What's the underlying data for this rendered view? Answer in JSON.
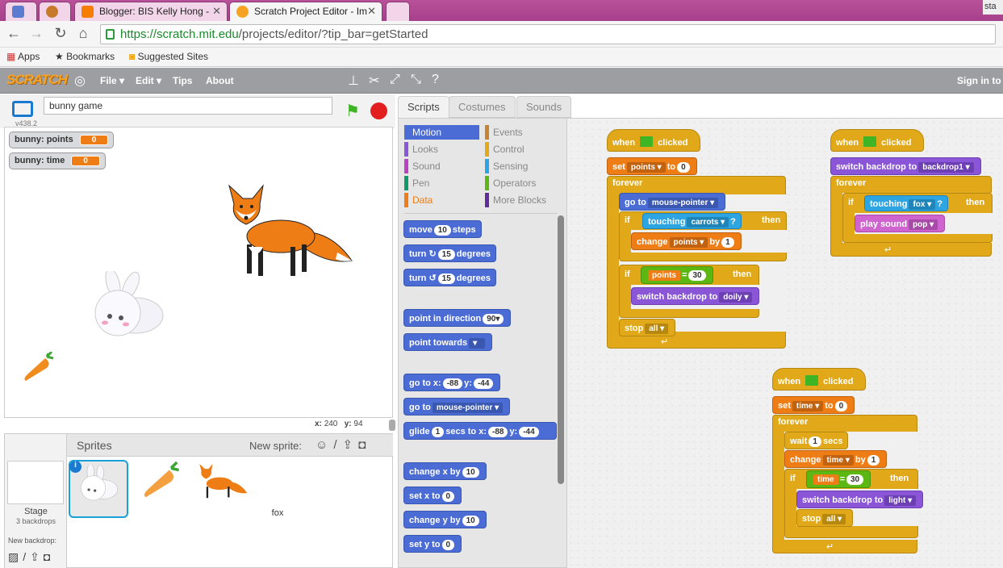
{
  "browser": {
    "tabs": [
      {
        "label": ""
      },
      {
        "label": "Blogger: BIS Kelly Hong -"
      },
      {
        "label": "Scratch Project Editor - Im"
      },
      {
        "label": ""
      }
    ],
    "url_prefix": "https://scratch.mit.edu",
    "url_rest": "/projects/editor/?tip_bar=getStarted",
    "bookmarks": [
      "Apps",
      "Bookmarks",
      "Suggested Sites"
    ],
    "corner_text": "sta"
  },
  "menubar": {
    "logo": "SCRATCH",
    "items": [
      "File ▾",
      "Edit ▾",
      "Tips",
      "About"
    ],
    "signin": "Sign in to s"
  },
  "stage": {
    "project_name": "bunny game",
    "version": "v438.2",
    "monitors": [
      {
        "label": "bunny: points",
        "value": "0"
      },
      {
        "label": "bunny: time",
        "value": "0"
      }
    ],
    "x_label": "x:",
    "x_value": "240",
    "y_label": "y:",
    "y_value": "94"
  },
  "sprites": {
    "header": "Sprites",
    "new_sprite": "New sprite:",
    "stage_label": "Stage",
    "stage_sub": "3 backdrops",
    "new_backdrop": "New backdrop:",
    "items": [
      "bunny",
      "carrots",
      "fox"
    ]
  },
  "editor_tabs": [
    "Scripts",
    "Costumes",
    "Sounds"
  ],
  "categories": {
    "left": [
      "Motion",
      "Looks",
      "Sound",
      "Pen",
      "Data"
    ],
    "right": [
      "Events",
      "Control",
      "Sensing",
      "Operators",
      "More Blocks"
    ]
  },
  "palette_blocks": {
    "move": [
      "move",
      "10",
      "steps"
    ],
    "turn_right": [
      "turn",
      "15",
      "degrees"
    ],
    "turn_left": [
      "turn",
      "15",
      "degrees"
    ],
    "point_dir": [
      "point in direction",
      "90▾"
    ],
    "point_towards": [
      "point towards"
    ],
    "goto_xy": [
      "go to x:",
      "-88",
      "y:",
      "-44"
    ],
    "goto": [
      "go to",
      "mouse-pointer ▾"
    ],
    "glide": [
      "glide",
      "1",
      "secs to x:",
      "-88",
      "y:",
      "-44"
    ],
    "change_x": [
      "change x by",
      "10"
    ],
    "set_x": [
      "set x to",
      "0"
    ],
    "change_y": [
      "change y by",
      "10"
    ],
    "set_y": [
      "set y to",
      "0"
    ]
  },
  "scripts": {
    "when": "when",
    "clicked": "clicked",
    "s1": {
      "set": "set",
      "points": "points ▾",
      "to": "to",
      "zero": "0",
      "forever": "forever",
      "goto": "go to",
      "mousepointer": "mouse-pointer ▾",
      "if": "if",
      "touching": "touching",
      "carrots": "carrots ▾",
      "q": "?",
      "then": "then",
      "change": "change",
      "points2": "points ▾",
      "by": "by",
      "one": "1",
      "points3": "points",
      "eq": "=",
      "thirty": "30",
      "switch": "switch backdrop to",
      "doily": "doily ▾",
      "stop": "stop",
      "all": "all ▾"
    },
    "s2": {
      "switch": "switch backdrop to",
      "backdrop1": "backdrop1 ▾",
      "forever": "forever",
      "if": "if",
      "touching": "touching",
      "fox": "fox ▾",
      "q": "?",
      "then": "then",
      "play": "play sound",
      "pop": "pop ▾"
    },
    "s3": {
      "set": "set",
      "time": "time ▾",
      "to": "to",
      "zero": "0",
      "forever": "forever",
      "wait": "wait",
      "one": "1",
      "secs": "secs",
      "change": "change",
      "time2": "time ▾",
      "by": "by",
      "one2": "1",
      "if": "if",
      "time3": "time",
      "eq": "=",
      "thirty": "30",
      "then": "then",
      "switch": "switch backdrop to",
      "light": "light ▾",
      "stop": "stop",
      "all": "all ▾"
    }
  }
}
